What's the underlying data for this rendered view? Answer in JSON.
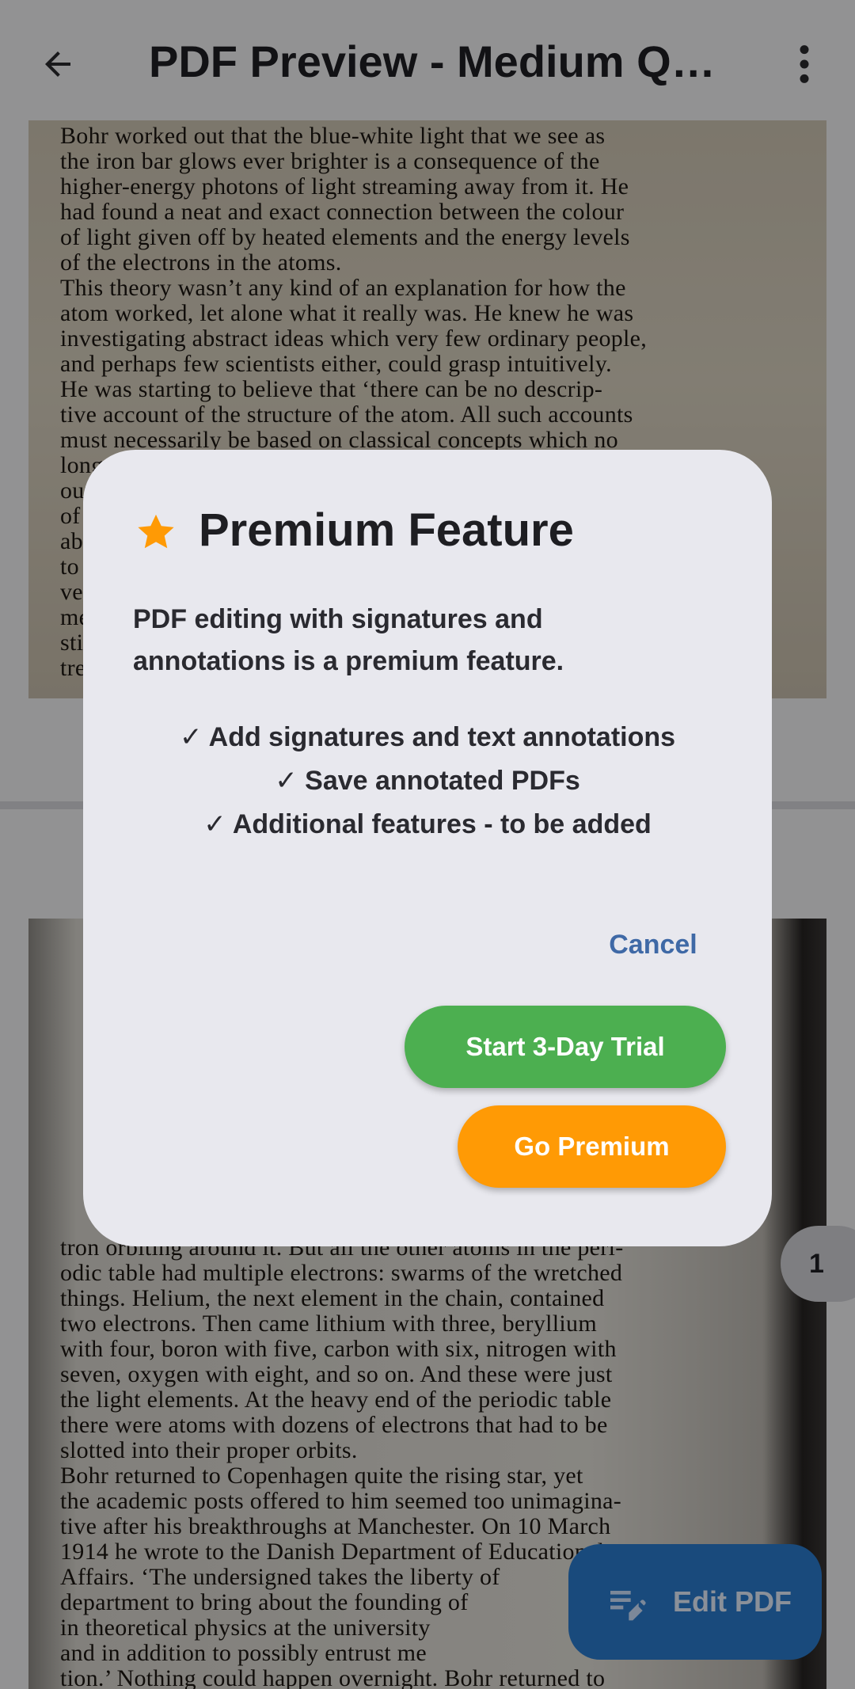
{
  "app_bar": {
    "title": "PDF Preview - Medium Qu...",
    "back_icon": "arrow-left-icon",
    "more_icon": "more-vertical-icon"
  },
  "page1_text": [
    "Bohr worked out that the blue-white light that we see as",
    "the iron bar glows ever brighter is a consequence of the",
    "higher-energy photons of light streaming away from it. He",
    "had found a neat and exact connection between the colour",
    "of light given off by heated elements and the energy levels",
    "of the electrons in the atoms.",
    "   This theory wasn’t any kind of an explanation for how the",
    "atom worked, let alone what it really was. He knew he was",
    "investigating abstract ideas which very few ordinary people,",
    "and perhaps few scientists either, could grasp intuitively.",
    "He was starting to believe that ‘there can be no descrip-",
    "tive account of the structure of the atom. All such accounts",
    "must necessarily be based on classical concepts which no",
    "longer apply. We lack the words in which to make",
    "ourselves understood in these matters’ and so every",
    "of scientists must use mathematics, which is able",
    "able to describe what language cannot, and be",
    "to the reader a description of what these",
    "very small things are like, even though the",
    "mere words we use will never be",
    "still good enough. Fortunately, there",
    "treatment which does not require us to"
  ],
  "page2_text": [
    "tron orbiting around it. But all the other atoms in the peri-",
    "odic table had multiple electrons: swarms of the wretched",
    "things. Helium, the next element in the chain, contained",
    "two electrons. Then came lithium with three, beryllium",
    "with four, boron with five, carbon with six, nitrogen with",
    "seven, oxygen with eight, and so on. And these were just",
    "the light elements. At the heavy end of the periodic table",
    "there were atoms with dozens of electrons that had to be",
    "slotted into their proper orbits.",
    "   Bohr returned to Copenhagen quite the rising star, yet",
    "the academic posts offered to him seemed too unimagina-",
    "tive after his breakthroughs at Manchester. On 10 March",
    "1914 he wrote to the Danish Department of Educational",
    "Affairs. ‘The undersigned takes the liberty of",
    "department to bring about the founding of",
    "in theoretical physics at the university",
    "and in addition to possibly entrust me",
    "tion.’ Nothing could happen overnight. Bohr returned to"
  ],
  "page_indicator": "1",
  "fab": {
    "label": "Edit PDF",
    "icon": "edit-note-icon"
  },
  "dialog": {
    "title": "Premium Feature",
    "title_icon": "star-icon",
    "body": "PDF editing with signatures and annotations is a premium feature.",
    "features": [
      "✓ Add signatures and text annotations",
      "✓ Save annotated PDFs",
      "✓ Additional features - to be added"
    ],
    "cancel_label": "Cancel",
    "trial_label": "Start 3-Day Trial",
    "premium_label": "Go Premium"
  },
  "colors": {
    "accent_star": "#ff9a05",
    "trial_button": "#4caf50",
    "premium_button": "#ff9a05",
    "cancel_text": "#3f69a6",
    "fab": "#2a7ccf"
  }
}
